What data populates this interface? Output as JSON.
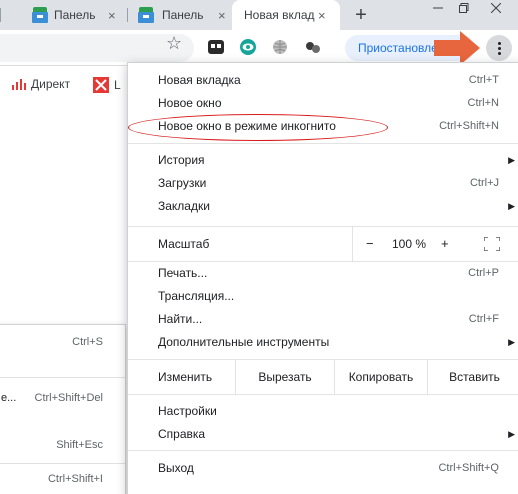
{
  "tabs": [
    {
      "title": "Панель",
      "close": "×"
    },
    {
      "title": "Панель",
      "close": "×"
    },
    {
      "title": "Новая вклад",
      "close": "×",
      "active": true
    }
  ],
  "newtab_symbol": "+",
  "toolbar": {
    "star": "☆",
    "pause_label": "Приостановлено"
  },
  "bookmarks": [
    {
      "label": "Директ"
    },
    {
      "label": "L"
    }
  ],
  "menu": {
    "new_tab": {
      "label": "Новая вкладка",
      "shortcut": "Ctrl+T"
    },
    "new_window": {
      "label": "Новое окно",
      "shortcut": "Ctrl+N"
    },
    "incognito": {
      "label": "Новое окно в режиме инкогнито",
      "shortcut": "Ctrl+Shift+N"
    },
    "history": {
      "label": "История"
    },
    "downloads": {
      "label": "Загрузки",
      "shortcut": "Ctrl+J"
    },
    "bookmarks": {
      "label": "Закладки"
    },
    "zoom": {
      "label": "Масштаб",
      "minus": "−",
      "value": "100 %",
      "plus": "+"
    },
    "print": {
      "label": "Печать...",
      "shortcut": "Ctrl+P"
    },
    "cast": {
      "label": "Трансляция..."
    },
    "find": {
      "label": "Найти...",
      "shortcut": "Ctrl+F"
    },
    "more_tools": {
      "label": "Дополнительные инструменты"
    },
    "edit": {
      "label": "Изменить",
      "cut": "Вырезать",
      "copy": "Копировать",
      "paste": "Вставить"
    },
    "settings": {
      "label": "Настройки"
    },
    "help": {
      "label": "Справка"
    },
    "exit": {
      "label": "Выход",
      "shortcut": "Ctrl+Shift+Q"
    },
    "chevron": "▶"
  },
  "submenu": {
    "save": {
      "shortcut": "Ctrl+S"
    },
    "clear": {
      "label_fragment": "е...",
      "shortcut": "Ctrl+Shift+Del"
    },
    "task_manager": {
      "shortcut": "Shift+Esc"
    },
    "devtools": {
      "shortcut": "Ctrl+Shift+I"
    }
  },
  "colors": {
    "annotation_red": "#d81c1c",
    "arrow_orange": "#e8663d",
    "pill_blue": "#1a73e8"
  }
}
